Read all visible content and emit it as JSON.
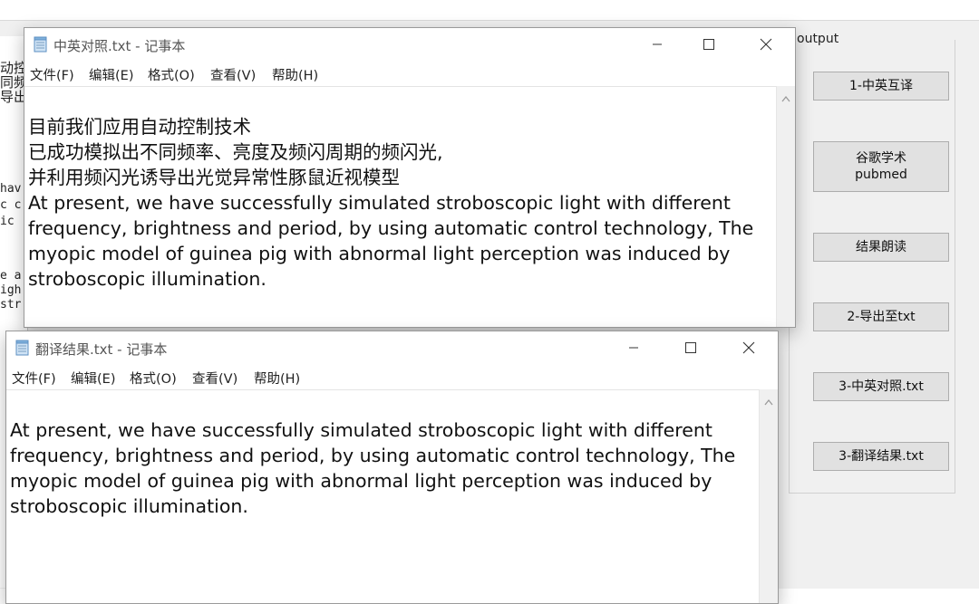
{
  "background_app": {
    "output_legend": "output",
    "buttons": [
      {
        "label": "1-中英互译"
      },
      {
        "label": "谷歌学术",
        "label2": "pubmed"
      },
      {
        "label": "结果朗读"
      },
      {
        "label": "2-导出至txt"
      },
      {
        "label": "3-中英对照.txt"
      },
      {
        "label": "3-翻译结果.txt"
      }
    ],
    "left_fragments": [
      "动控",
      "同频",
      "导出",
      "hav",
      "c c",
      "ic",
      "e a",
      "igh",
      "str"
    ]
  },
  "windows": [
    {
      "title": "中英对照.txt - 记事本",
      "menu": [
        "文件(F)",
        "编辑(E)",
        "格式(O)",
        "查看(V)",
        "帮助(H)"
      ],
      "lines": [
        "目前我们应用自动控制技术",
        "已成功模拟出不同频率、亮度及频闪周期的频闪光,",
        "并利用频闪光诱导出光觉异常性豚鼠近视模型",
        "At present, we have successfully simulated stroboscopic light with different",
        "frequency, brightness and period, by using automatic control technology, The",
        "myopic model of guinea pig with abnormal light perception was induced by",
        "stroboscopic illumination."
      ]
    },
    {
      "title": "翻译结果.txt - 记事本",
      "menu": [
        "文件(F)",
        "编辑(E)",
        "格式(O)",
        "查看(V)",
        "帮助(H)"
      ],
      "lines": [
        "At present, we have successfully simulated stroboscopic light with different",
        "frequency, brightness and period, by using automatic control technology, The",
        "myopic model of guinea pig with abnormal light perception was induced by",
        "stroboscopic illumination."
      ]
    }
  ],
  "icons": {
    "minimize": "minimize-icon",
    "maximize": "maximize-icon",
    "close": "close-icon",
    "app": "notepad-icon"
  }
}
